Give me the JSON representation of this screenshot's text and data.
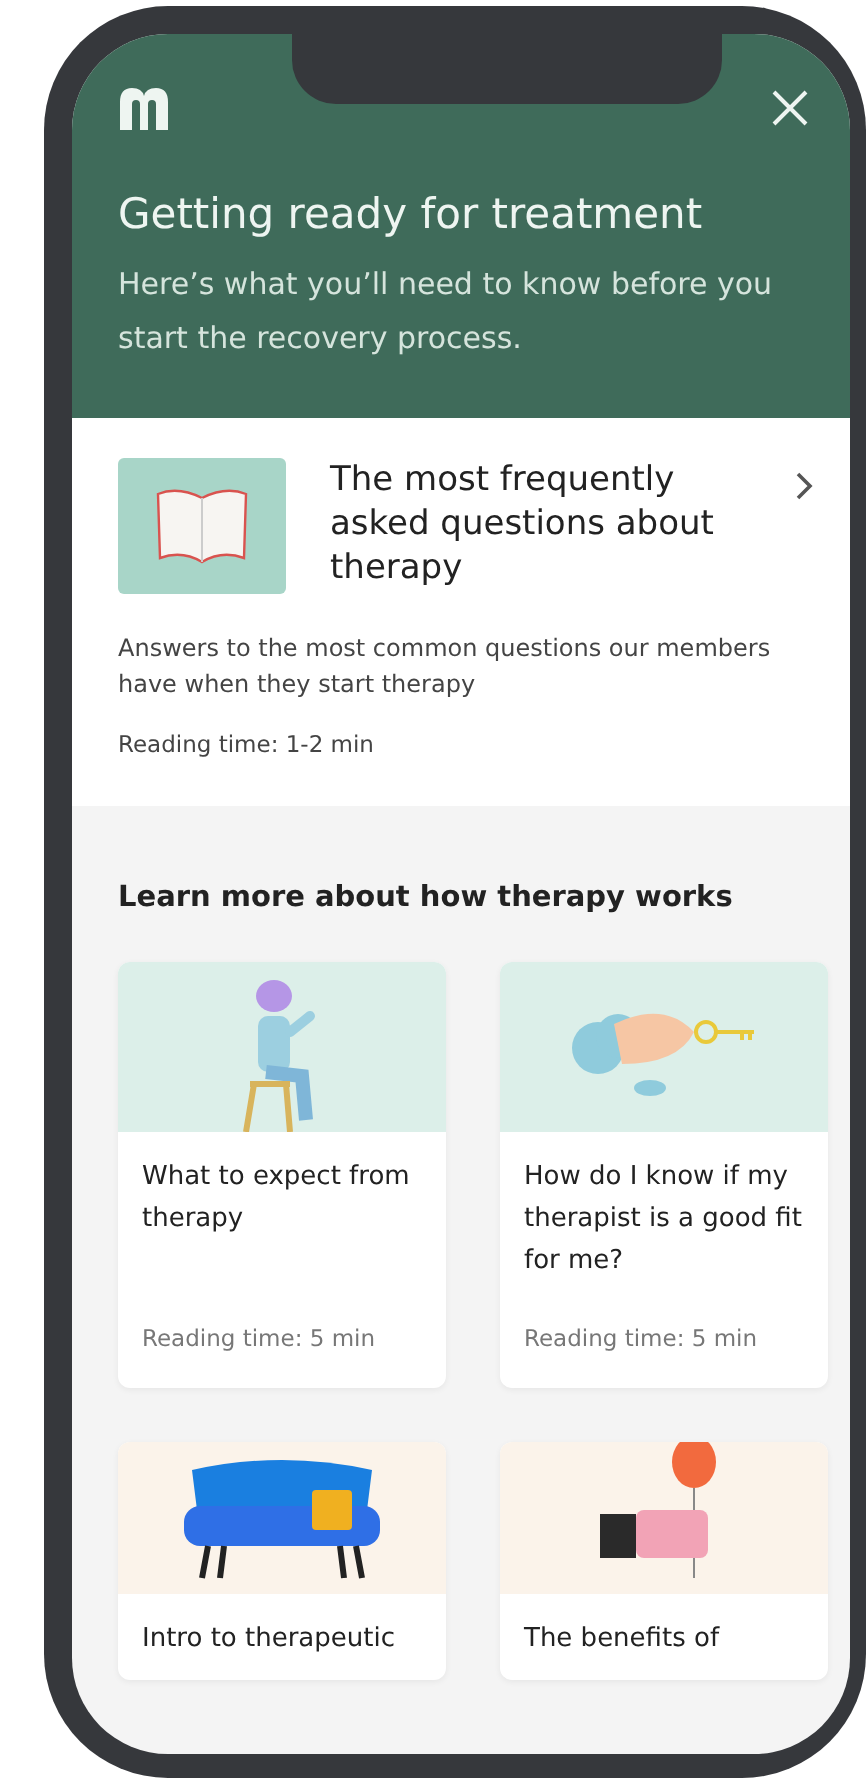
{
  "header": {
    "title": "Getting ready for treatment",
    "subtitle": "Here’s what you’ll need to know before you start the recovery process."
  },
  "featured": {
    "title": "The most frequently asked questions about therapy",
    "description": "Answers to the most common questions our members have when they start therapy",
    "reading_time": "Reading time: 1-2 min"
  },
  "section": {
    "heading": "Learn more about how therapy works",
    "articles": [
      {
        "title": "What to expect from therapy",
        "reading_time": "Reading time: 5 min"
      },
      {
        "title": "How do I know if my therapist is a good fit for me?",
        "reading_time": "Reading time: 5 min"
      },
      {
        "title": "Intro to therapeutic"
      },
      {
        "title": "The benefits of"
      }
    ]
  }
}
